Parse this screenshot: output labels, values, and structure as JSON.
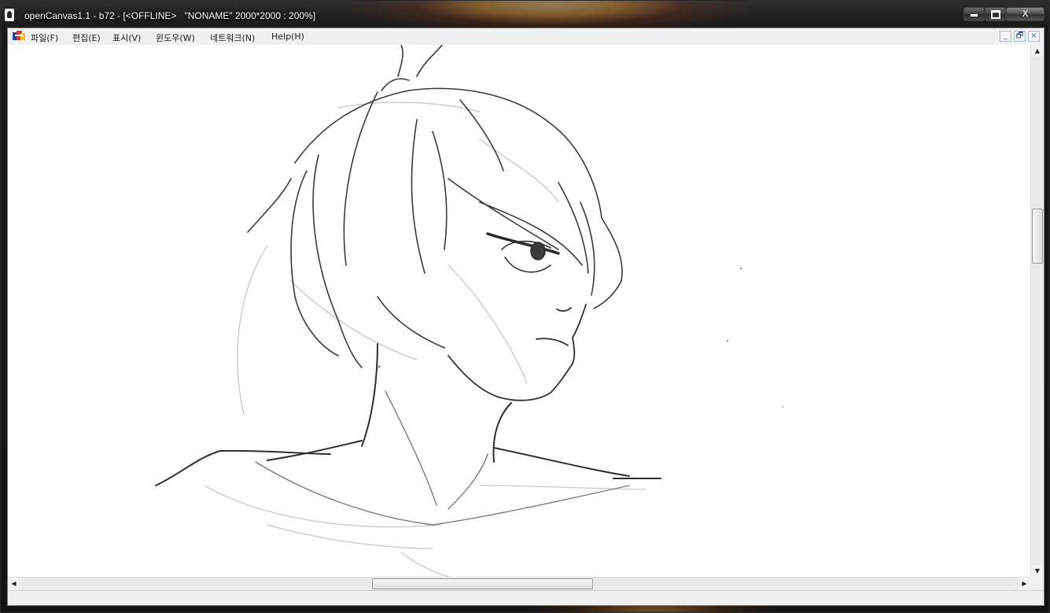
{
  "window": {
    "title": "openCanvas1.1 - b72 - [<OFFLINE>   \"NONAME\" 2000*2000 : 200%]",
    "minimize_glyph": "",
    "close_glyph": "X"
  },
  "menubar": {
    "items": [
      {
        "label": "파일(F)"
      },
      {
        "label": "편집(E)"
      },
      {
        "label": "표시(V)"
      },
      {
        "label": "윈도우(W)"
      },
      {
        "label": "네트워크(N)"
      },
      {
        "label": "Help(H)"
      }
    ],
    "mdi_minimize": "_",
    "mdi_restore": "🗗",
    "mdi_close": "×"
  },
  "scrollbars": {
    "up_arrow": "▲",
    "down_arrow": "▼",
    "left_arrow": "◀",
    "right_arrow": "▶"
  },
  "colors": {
    "canvas": "#ffffff",
    "sketch_stroke": "#2a2a2a",
    "light_stroke": "#b5b5b5"
  }
}
